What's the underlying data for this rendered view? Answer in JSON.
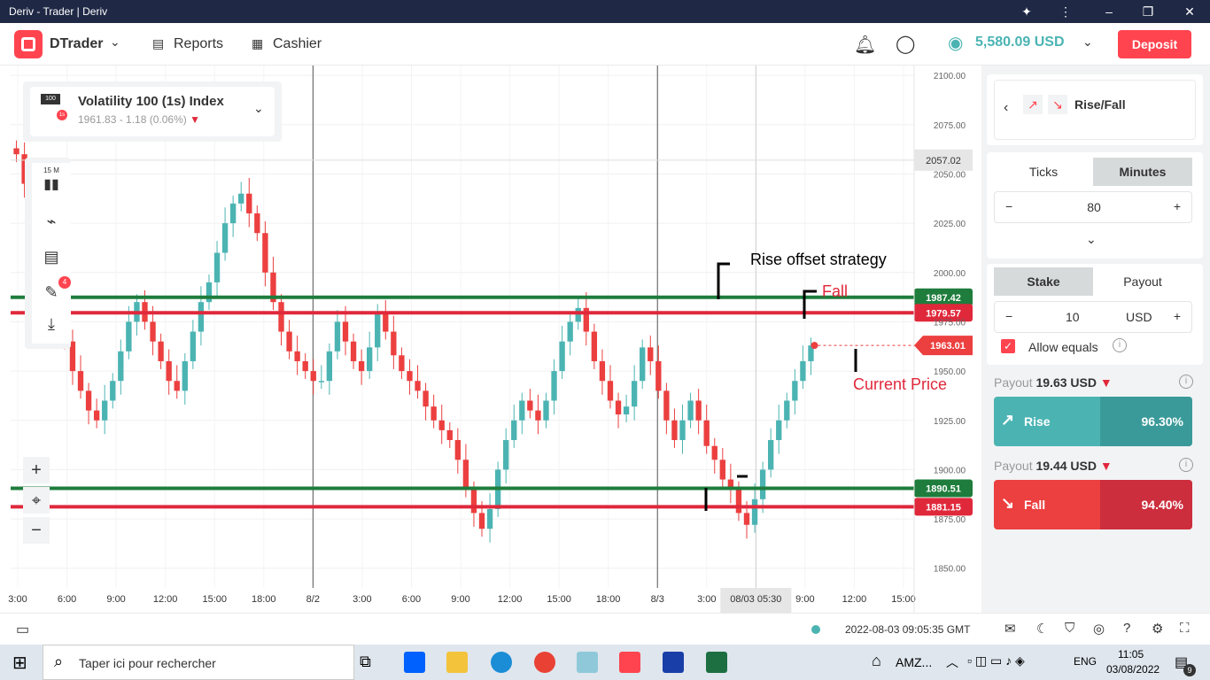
{
  "window": {
    "title": "Deriv - Trader | Deriv"
  },
  "header": {
    "app_name": "DTrader",
    "nav": [
      {
        "label": "Reports"
      },
      {
        "label": "Cashier"
      }
    ],
    "balance": "5,580.09 USD",
    "deposit_label": "Deposit"
  },
  "symbol": {
    "name": "Volatility 100 (1s) Index",
    "quote": "1961.83 - 1.18 (0.06%)",
    "icon_badge": "100",
    "icon_sub": "1s"
  },
  "toolbar": {
    "interval": "15 M",
    "drawing_count": "4"
  },
  "chart_data": {
    "type": "candlestick",
    "ylim": [
      1840,
      2105
    ],
    "y_ticks": [
      "2100.00",
      "2075.00",
      "2050.00",
      "2025.00",
      "2000.00",
      "1975.00",
      "1950.00",
      "1925.00",
      "1900.00",
      "1875.00",
      "1850.00"
    ],
    "x_ticks": [
      "3:00",
      "6:00",
      "9:00",
      "12:00",
      "15:00",
      "18:00",
      "8/2",
      "3:00",
      "6:00",
      "9:00",
      "12:00",
      "15:00",
      "18:00",
      "8/3",
      "3:00",
      "08/03 05:30",
      "9:00",
      "12:00",
      "15:00"
    ],
    "hover_price": "2057.02",
    "hover_time": "08/03 05:30",
    "current_price": "1963.01",
    "horizontal_lines": [
      {
        "label": "1987.42",
        "value": 1987.42,
        "color": "#1e7d3c"
      },
      {
        "label": "1979.57",
        "value": 1979.57,
        "color": "#e0283b"
      },
      {
        "label": "1890.51",
        "value": 1890.51,
        "color": "#1e7d3c"
      },
      {
        "label": "1881.15",
        "value": 1881.15,
        "color": "#e0283b"
      }
    ],
    "annotations": [
      {
        "text": "Rise offset strategy",
        "color": "#000000"
      },
      {
        "text": "Fall",
        "color": "#e0283b"
      },
      {
        "text": "Current Price",
        "color": "#e0283b"
      }
    ],
    "series": [
      {
        "name": "",
        "values": [
          2060,
          2045,
          2030,
          2005,
          1990,
          1975,
          1965,
          1950,
          1940,
          1930,
          1925,
          1935,
          1945,
          1960,
          1975,
          1985,
          1975,
          1965,
          1955,
          1945,
          1940,
          1955,
          1970,
          1985,
          1995,
          2010,
          2025,
          2035,
          2040,
          2030,
          2020,
          2000,
          1985,
          1970,
          1960,
          1955,
          1950,
          1945,
          1945,
          1960,
          1975,
          1965,
          1955,
          1950,
          1962,
          1980,
          1970,
          1958,
          1950,
          1945,
          1940,
          1932,
          1925,
          1920,
          1915,
          1905,
          1890,
          1878,
          1870,
          1880,
          1900,
          1915,
          1925,
          1935,
          1930,
          1925,
          1935,
          1950,
          1965,
          1975,
          1982,
          1970,
          1955,
          1945,
          1935,
          1928,
          1932,
          1945,
          1962,
          1955,
          1940,
          1925,
          1915,
          1925,
          1935,
          1925,
          1912,
          1905,
          1895,
          1890,
          1878,
          1872,
          1885,
          1900,
          1915,
          1925,
          1935,
          1945,
          1955,
          1963
        ]
      }
    ]
  },
  "trade": {
    "contract": "Rise/Fall",
    "duration_tabs": [
      "Ticks",
      "Minutes"
    ],
    "duration_value": "80",
    "stake_tabs": [
      "Stake",
      "Payout"
    ],
    "stake_value": "10",
    "currency": "USD",
    "allow_equals": "Allow equals",
    "rise": {
      "payout_label": "Payout",
      "payout": "19.63 USD",
      "label": "Rise",
      "percent": "96.30%"
    },
    "fall": {
      "payout_label": "Payout",
      "payout": "19.44 USD",
      "label": "Fall",
      "percent": "94.40%"
    }
  },
  "footer": {
    "time": "2022-08-03 09:05:35 GMT"
  },
  "taskbar": {
    "search_placeholder": "Taper ici pour rechercher",
    "tray_app": "AMZ...",
    "lang": "ENG",
    "time": "11:05",
    "date": "03/08/2022",
    "notif_count": "9"
  }
}
